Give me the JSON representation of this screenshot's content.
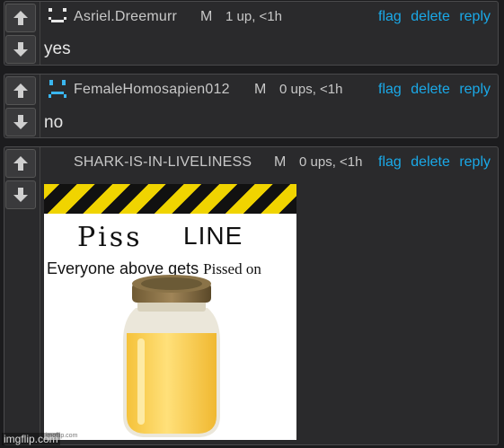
{
  "comments": [
    {
      "username": "Asriel.Dreemurr",
      "gender": "M",
      "meta": "1 up, <1h",
      "text": "yes",
      "avatar_icon": "happy-face-icon"
    },
    {
      "username": "FemaleHomosapien012",
      "gender": "M",
      "meta": "0 ups, <1h",
      "text": "no",
      "avatar_icon": "sad-face-icon"
    },
    {
      "username": "SHARK-IS-IN-LIVELINESS",
      "gender": "M",
      "meta": "0 ups, <1h",
      "text": "",
      "avatar_icon": ""
    }
  ],
  "actions": {
    "flag": "flag",
    "delete": "delete",
    "reply": "reply"
  },
  "meme": {
    "word1": "Piss",
    "word2": "LINE",
    "caption_main": "Everyone above gets",
    "caption_serif": "Pissed on",
    "credit": "imgflip.com"
  },
  "watermark": "imgflip.com",
  "colors": {
    "link": "#1aa9e8",
    "background": "#1c1c1e",
    "panel": "#2a2a2c",
    "hazard_yellow": "#f0d400"
  }
}
